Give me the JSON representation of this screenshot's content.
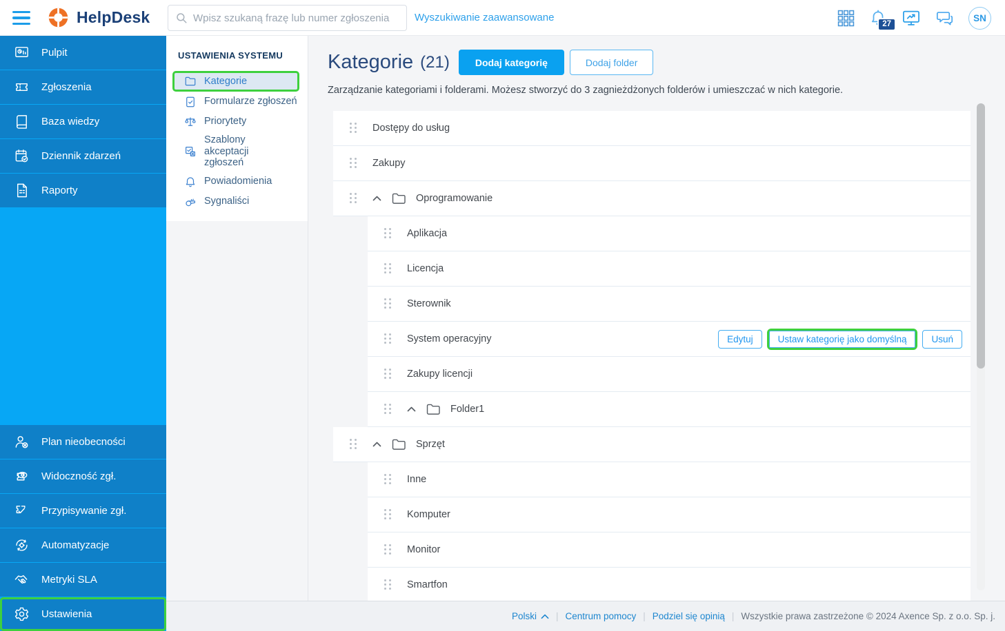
{
  "colors": {
    "accent_blue": "#0aa1f0",
    "sidebar_bg": "#07a7f5",
    "sidebar_item_bg": "#0f80c8",
    "highlight_green": "#3ed03e",
    "badge_navy": "#1d5096",
    "title_navy": "#2a4a7d"
  },
  "topbar": {
    "brand": "HelpDesk",
    "search_placeholder": "Wpisz szukaną frazę lub numer zgłoszenia",
    "advanced_search_label": "Wyszukiwanie zaawansowane",
    "notification_count": "27",
    "avatar_initials": "SN",
    "icons": [
      "menu-icon",
      "search-icon",
      "apps-grid-icon",
      "bell-icon",
      "monitor-icon",
      "chat-icon",
      "avatar"
    ]
  },
  "sidebar": {
    "top_items": [
      {
        "label": "Pulpit",
        "icon": "dashboard-icon"
      },
      {
        "label": "Zgłoszenia",
        "icon": "ticket-icon"
      },
      {
        "label": "Baza wiedzy",
        "icon": "book-icon"
      },
      {
        "label": "Dziennik zdarzeń",
        "icon": "journal-check-icon"
      },
      {
        "label": "Raporty",
        "icon": "report-icon"
      }
    ],
    "bottom_items": [
      {
        "label": "Plan nieobecności",
        "icon": "user-absence-icon"
      },
      {
        "label": "Widoczność zgł.",
        "icon": "visibility-icon"
      },
      {
        "label": "Przypisywanie zgł.",
        "icon": "assign-ticket-icon"
      },
      {
        "label": "Automatyzacje",
        "icon": "automation-icon"
      },
      {
        "label": "Metryki SLA",
        "icon": "handshake-icon"
      },
      {
        "label": "Ustawienia",
        "icon": "gear-icon",
        "active": true
      }
    ]
  },
  "settings_nav": {
    "header": "USTAWIENIA SYSTEMU",
    "items": [
      {
        "label": "Kategorie",
        "icon": "folder-icon",
        "active": true
      },
      {
        "label": "Formularze zgłoszeń",
        "icon": "form-check-icon"
      },
      {
        "label": "Priorytety",
        "icon": "scales-icon"
      },
      {
        "label": "Szablony akceptacji zgłoszeń",
        "icon": "approval-template-icon"
      },
      {
        "label": "Powiadomienia",
        "icon": "bell-icon"
      },
      {
        "label": "Sygnaliści",
        "icon": "whistle-icon"
      }
    ]
  },
  "main": {
    "title": "Kategorie",
    "count": "(21)",
    "buttons": {
      "add_category": "Dodaj kategorię",
      "add_folder": "Dodaj folder"
    },
    "description": "Zarządzanie kategoriami i folderami. Możesz stworzyć do 3 zagnieżdżonych folderów i umieszczać w nich kategorie.",
    "row_actions": {
      "edit": "Edytuj",
      "set_default": "Ustaw kategorię jako domyślną",
      "delete": "Usuń"
    },
    "rows": [
      {
        "type": "category",
        "level": 0,
        "label": "Dostępy do usług"
      },
      {
        "type": "category",
        "level": 0,
        "label": "Zakupy"
      },
      {
        "type": "folder",
        "level": 0,
        "label": "Oprogramowanie",
        "expanded": true
      },
      {
        "type": "category",
        "level": 1,
        "label": "Aplikacja"
      },
      {
        "type": "category",
        "level": 1,
        "label": "Licencja"
      },
      {
        "type": "category",
        "level": 1,
        "label": "Sterownik"
      },
      {
        "type": "category",
        "level": 1,
        "label": "System operacyjny",
        "actions_visible": true,
        "default_button_highlighted": true
      },
      {
        "type": "category",
        "level": 1,
        "label": "Zakupy licencji"
      },
      {
        "type": "folder",
        "level": 1,
        "label": "Folder1",
        "expanded": true
      },
      {
        "type": "folder",
        "level": 0,
        "label": "Sprzęt",
        "expanded": true
      },
      {
        "type": "category",
        "level": 1,
        "label": "Inne"
      },
      {
        "type": "category",
        "level": 1,
        "label": "Komputer"
      },
      {
        "type": "category",
        "level": 1,
        "label": "Monitor"
      },
      {
        "type": "category",
        "level": 1,
        "label": "Smartfon"
      }
    ]
  },
  "footer": {
    "language": "Polski",
    "help_label": "Centrum pomocy",
    "feedback_label": "Podziel się opinią",
    "copyright": "Wszystkie prawa zastrzeżone © 2024 Axence Sp. z o.o. Sp. j."
  }
}
